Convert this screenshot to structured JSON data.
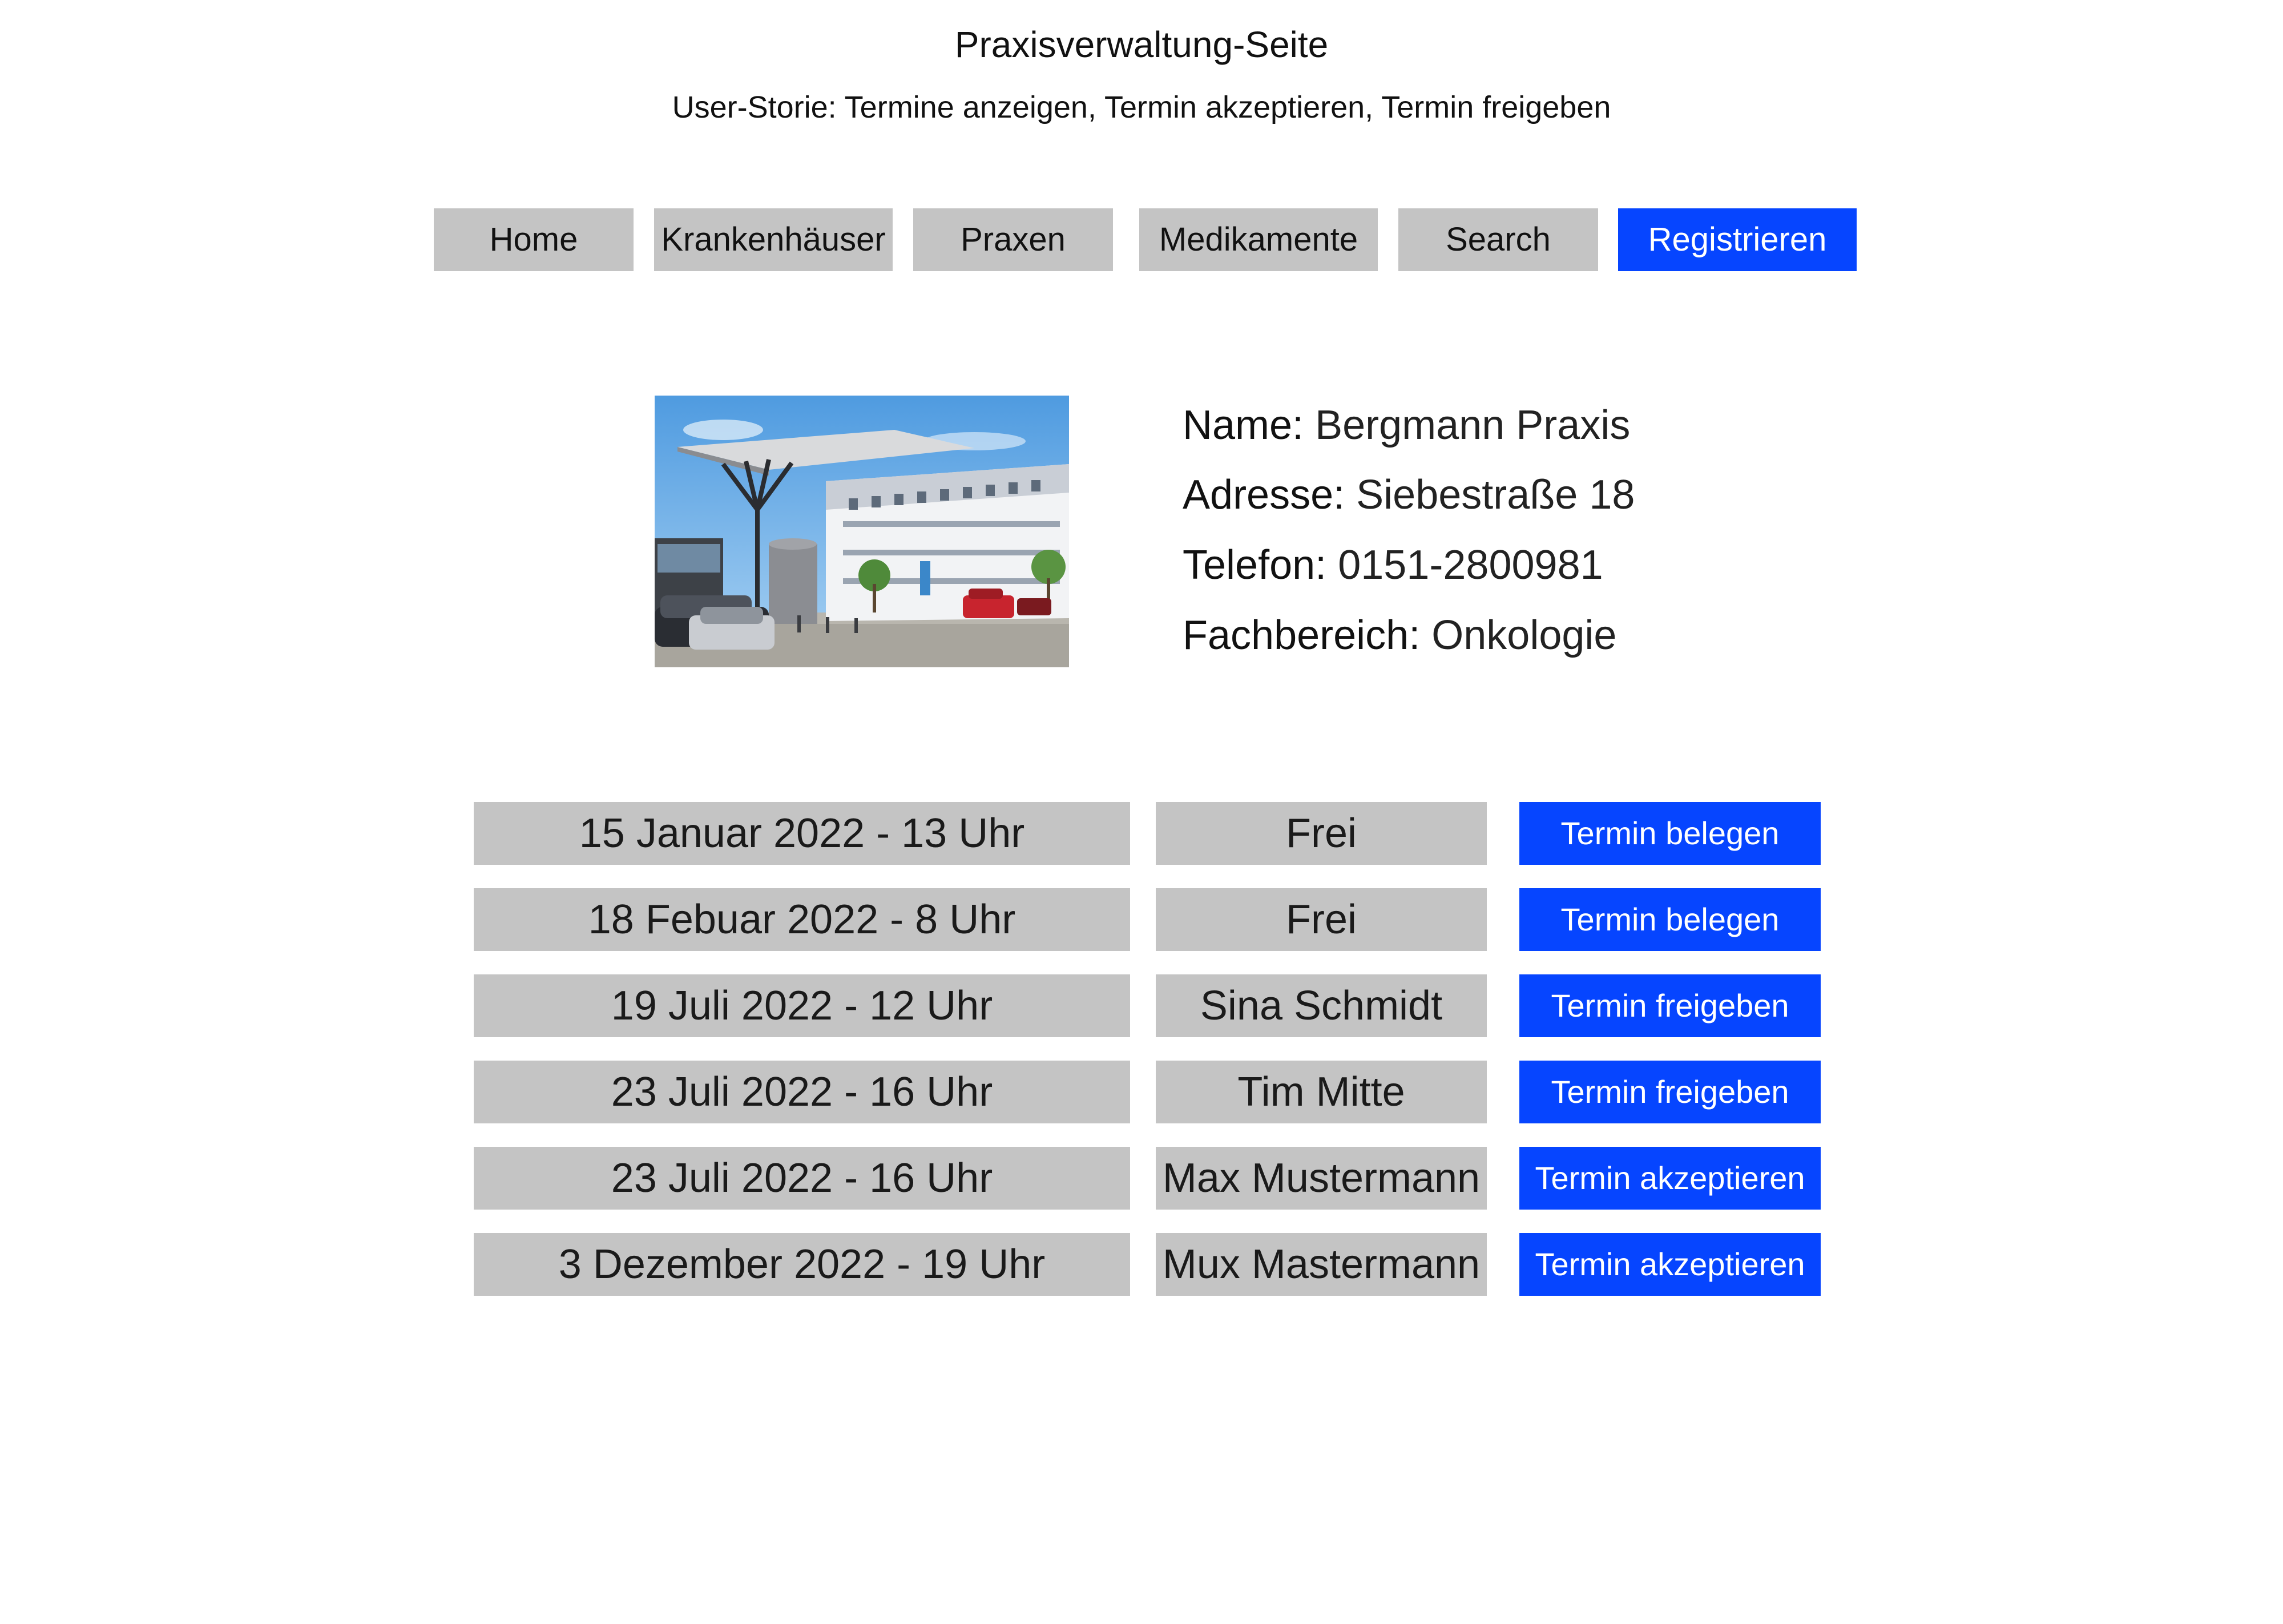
{
  "header": {
    "title": "Praxisverwaltung-Seite",
    "subtitle": "User-Storie: Termine anzeigen, Termin akzeptieren, Termin freigeben"
  },
  "nav": {
    "home": "Home",
    "krankenhaeuser": "Krankenhäuser",
    "praxen": "Praxen",
    "medikamente": "Medikamente",
    "search": "Search",
    "registrieren": "Registrieren"
  },
  "colors": {
    "accent": "#0645ff",
    "button_gray": "#c4c4c4"
  },
  "practice": {
    "name_label": "Name:",
    "name": "Bergmann Praxis",
    "address_label": "Adresse:",
    "address": "Siebestraße 18",
    "phone_label": "Telefon:",
    "phone": "0151-2800981",
    "field_label": "Fachbereich:",
    "field": "Onkologie"
  },
  "appointments": [
    {
      "date": "15 Januar 2022 - 13 Uhr",
      "status": "Frei",
      "action": "Termin belegen"
    },
    {
      "date": "18 Febuar 2022 - 8 Uhr",
      "status": "Frei",
      "action": "Termin belegen"
    },
    {
      "date": "19 Juli 2022 - 12 Uhr",
      "status": "Sina Schmidt",
      "action": "Termin freigeben"
    },
    {
      "date": "23 Juli 2022 - 16 Uhr",
      "status": "Tim Mitte",
      "action": "Termin freigeben"
    },
    {
      "date": "23 Juli 2022 - 16 Uhr",
      "status": "Max Mustermann",
      "action": "Termin akzeptieren"
    },
    {
      "date": "3 Dezember 2022 - 19 Uhr",
      "status": "Mux Mastermann",
      "action": "Termin akzeptieren"
    }
  ]
}
